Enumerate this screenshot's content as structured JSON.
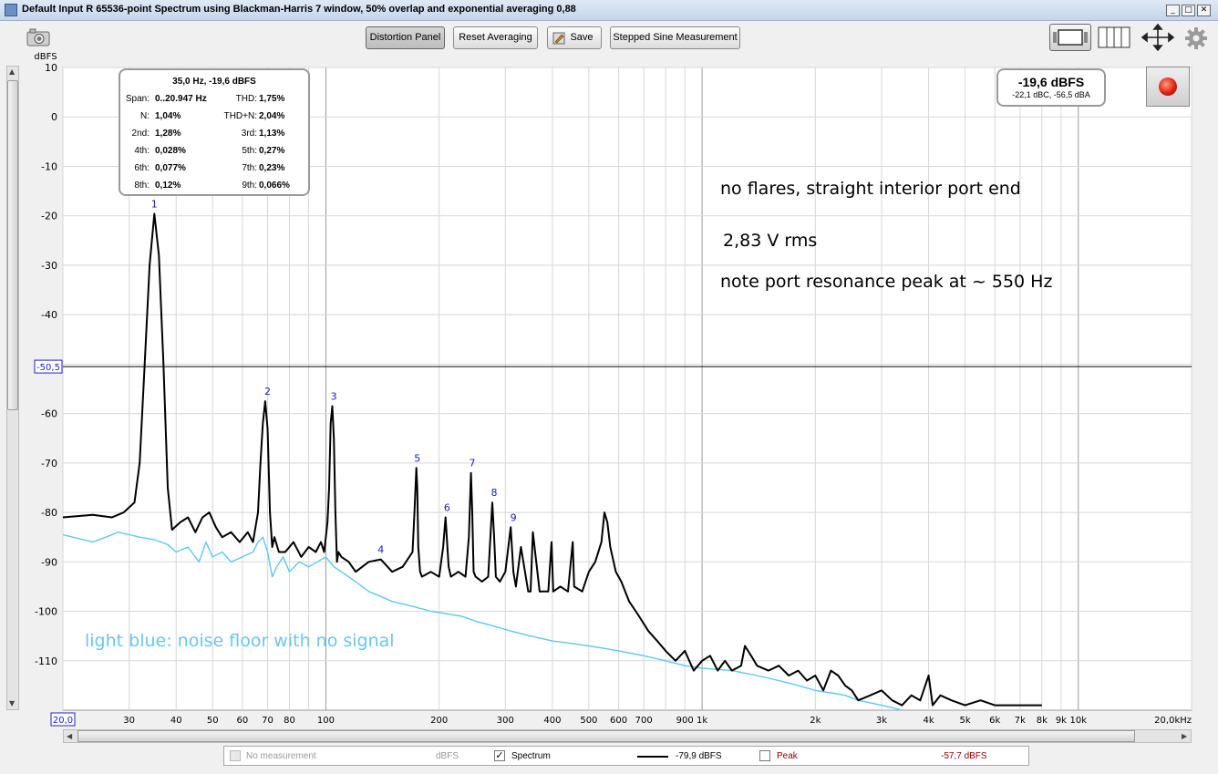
{
  "window": {
    "title": "Default Input R 65536-point Spectrum using Blackman-Harris 7 window, 50% overlap and exponential averaging 0,88",
    "min_glyph": "_",
    "max_glyph": "□",
    "close_glyph": "✕"
  },
  "toolbar": {
    "distortion_panel": "Distortion Panel",
    "reset_averaging": "Reset Averaging",
    "save": "Save",
    "stepped_sine": "Stepped Sine Measurement"
  },
  "info_box": {
    "title": "35,0 Hz, -19,6 dBFS",
    "rows": [
      {
        "l1": "Span:",
        "v1": "0..20.947 Hz",
        "l2": "THD:",
        "v2": "1,75%"
      },
      {
        "l1": "N:",
        "v1": "1,04%",
        "l2": "THD+N:",
        "v2": "2,04%"
      },
      {
        "l1": "2nd:",
        "v1": "1,28%",
        "l2": "3rd:",
        "v2": "1,13%"
      },
      {
        "l1": "4th:",
        "v1": "0,028%",
        "l2": "5th:",
        "v2": "0,27%"
      },
      {
        "l1": "6th:",
        "v1": "0,077%",
        "l2": "7th:",
        "v2": "0,23%"
      },
      {
        "l1": "8th:",
        "v1": "0,12%",
        "l2": "9th:",
        "v2": "0,066%"
      }
    ]
  },
  "level_box": {
    "main": "-19,6 dBFS",
    "sub": "-22,1 dBC, -56,5 dBA"
  },
  "annotations": {
    "line1": "no flares, straight interior port end",
    "line2": "2,83 V rms",
    "line3": "note port resonance peak at ~ 550 Hz",
    "line4": "light blue: noise floor with no signal"
  },
  "colors": {
    "spectrum": "#000000",
    "noise": "#5ec8f2",
    "harmonic_label": "#1a1ac8",
    "grid": "#d8d8d8",
    "annotation_blue": "#6ec4ee",
    "peak_text": "#8b0000"
  },
  "legend": {
    "no_measurement": "No measurement",
    "no_measurement_unit": "dBFS",
    "spectrum": "Spectrum",
    "spectrum_value": "-79,9 dBFS",
    "peak": "Peak",
    "peak_value": "-57,7 dBFS",
    "check_glyph": "✓"
  },
  "chart_data": {
    "type": "line",
    "x_scale": "log",
    "xlim": [
      20,
      20000
    ],
    "ylim": [
      -120,
      10
    ],
    "ylabel": "dBFS",
    "y_ticks": [
      10,
      0,
      -10,
      -20,
      -30,
      -40,
      -50,
      -60,
      -70,
      -80,
      -90,
      -100,
      -110
    ],
    "y_tick_labels": [
      "10",
      "0",
      "-10",
      "-20",
      "-30",
      "-40",
      "-50",
      "-60",
      "-70",
      "-80",
      "-90",
      "-100",
      "-110"
    ],
    "x_tick_values": [
      20,
      30,
      40,
      50,
      60,
      70,
      80,
      100,
      200,
      300,
      400,
      500,
      600,
      700,
      900,
      1000,
      2000,
      3000,
      4000,
      5000,
      6000,
      7000,
      8000,
      9000,
      10000,
      20000
    ],
    "x_tick_labels": [
      "20,0",
      "30",
      "40",
      "50",
      "60",
      "70",
      "80",
      "100",
      "200",
      "300",
      "400",
      "500",
      "600",
      "700",
      "900",
      "1k",
      "2k",
      "3k",
      "4k",
      "5k",
      "6k",
      "7k",
      "8k",
      "9k",
      "10k",
      "20,0kHz"
    ],
    "grid": true,
    "cursor_line": {
      "y": -50.5,
      "label": "-50,5"
    },
    "harmonics": [
      {
        "label": "1",
        "x": 35,
        "y": -19.6
      },
      {
        "label": "2",
        "x": 70,
        "y": -57.5
      },
      {
        "label": "3",
        "x": 105,
        "y": -58.5
      },
      {
        "label": "4",
        "x": 140,
        "y": -89.5
      },
      {
        "label": "5",
        "x": 175,
        "y": -71
      },
      {
        "label": "6",
        "x": 210,
        "y": -81
      },
      {
        "label": "7",
        "x": 245,
        "y": -72
      },
      {
        "label": "8",
        "x": 280,
        "y": -78
      },
      {
        "label": "9",
        "x": 315,
        "y": -83
      }
    ],
    "series": [
      {
        "name": "Spectrum",
        "x": [
          20,
          24,
          27,
          29,
          31,
          32,
          33,
          34,
          35,
          36,
          37,
          38,
          39,
          41,
          43,
          45,
          47,
          49,
          51,
          53,
          56,
          59,
          62,
          64,
          66,
          67,
          68,
          69,
          70,
          71,
          72,
          73,
          75,
          78,
          82,
          86,
          90,
          94,
          97,
          99,
          101,
          102,
          103,
          104,
          105,
          106,
          107,
          108,
          110,
          115,
          120,
          130,
          140,
          150,
          160,
          170,
          172,
          174,
          175,
          176,
          178,
          180,
          190,
          200,
          205,
          208,
          210,
          212,
          215,
          225,
          235,
          240,
          243,
          245,
          247,
          250,
          260,
          270,
          277,
          280,
          283,
          290,
          300,
          310,
          315,
          320,
          330,
          345,
          350,
          355,
          370,
          390,
          398,
          402,
          420,
          440,
          453,
          457,
          480,
          500,
          520,
          540,
          550,
          560,
          570,
          590,
          610,
          640,
          680,
          720,
          760,
          800,
          850,
          900,
          950,
          1000,
          1050,
          1100,
          1150,
          1200,
          1270,
          1300,
          1350,
          1400,
          1500,
          1600,
          1700,
          1800,
          1900,
          2000,
          2100,
          2200,
          2300,
          2400,
          2500,
          2600,
          2800,
          3000,
          3200,
          3400,
          3600,
          3800,
          4000,
          4100,
          4300,
          4600,
          5000,
          5500,
          6000,
          7000,
          8000
        ],
        "y": [
          -81,
          -80.5,
          -81,
          -80,
          -78,
          -70,
          -50,
          -30,
          -19.6,
          -28,
          -50,
          -75,
          -83.5,
          -82,
          -81,
          -84,
          -81,
          -80,
          -83,
          -85,
          -84,
          -86,
          -84,
          -86,
          -80,
          -70,
          -62,
          -57.5,
          -63,
          -80,
          -87,
          -85,
          -88,
          -88,
          -86,
          -89,
          -87,
          -88,
          -86,
          -88,
          -82,
          -75,
          -62,
          -58.5,
          -65,
          -80,
          -90,
          -88,
          -89,
          -90,
          -92,
          -90,
          -89.5,
          -92,
          -91,
          -88,
          -80,
          -71,
          -75,
          -87,
          -92,
          -93,
          -92,
          -93,
          -87,
          -81,
          -86,
          -91,
          -93,
          -92,
          -93,
          -85,
          -72,
          -80,
          -92,
          -93,
          -94,
          -93,
          -78,
          -85,
          -93,
          -94,
          -92,
          -83,
          -92,
          -95,
          -87,
          -96,
          -96,
          -84,
          -96,
          -96,
          -86,
          -96,
          -95,
          -96,
          -86,
          -95,
          -96,
          -92,
          -90,
          -86,
          -80,
          -82,
          -87,
          -92,
          -94,
          -98,
          -101,
          -104,
          -106,
          -108,
          -110,
          -108,
          -112,
          -110,
          -109,
          -112,
          -110,
          -112,
          -111,
          -107,
          -109,
          -111,
          -112,
          -111,
          -113,
          -112,
          -114,
          -113,
          -116,
          -112,
          -113,
          -115,
          -116,
          -118,
          -117,
          -116,
          -118,
          -119,
          -117,
          -118,
          -113,
          -119,
          -117,
          -118,
          -119,
          -118,
          -119,
          -119,
          -119
        ]
      },
      {
        "name": "",
        "x": [
          20,
          24,
          26,
          28,
          30,
          32,
          35,
          38,
          40,
          43,
          46,
          48,
          50,
          53,
          56,
          60,
          64,
          66,
          68,
          70,
          72,
          74,
          77,
          80,
          85,
          90,
          95,
          100,
          105,
          110,
          120,
          130,
          140,
          150,
          170,
          190,
          210,
          230,
          250,
          280,
          310,
          350,
          400,
          450,
          500,
          550,
          600,
          700,
          800,
          900,
          1000,
          1200,
          1400,
          1600,
          1800,
          2000,
          2200,
          2400,
          2600,
          2800,
          3000,
          3200,
          3400
        ],
        "y": [
          -84.5,
          -86,
          -85,
          -84,
          -84.5,
          -85,
          -85.5,
          -86.5,
          -88,
          -87,
          -90,
          -86,
          -89,
          -88,
          -90,
          -89,
          -88,
          -86,
          -85,
          -88,
          -93,
          -91,
          -89,
          -92,
          -90,
          -91,
          -90,
          -89,
          -91,
          -92,
          -94,
          -96,
          -97,
          -98,
          -99,
          -100,
          -100.5,
          -101,
          -102,
          -103,
          -104,
          -105,
          -106,
          -106.5,
          -107,
          -107.5,
          -108,
          -109,
          -110,
          -111,
          -111.5,
          -112,
          -113,
          -114,
          -115,
          -116,
          -116.5,
          -117,
          -118,
          -118.5,
          -119,
          -119.5,
          -120
        ]
      }
    ]
  }
}
